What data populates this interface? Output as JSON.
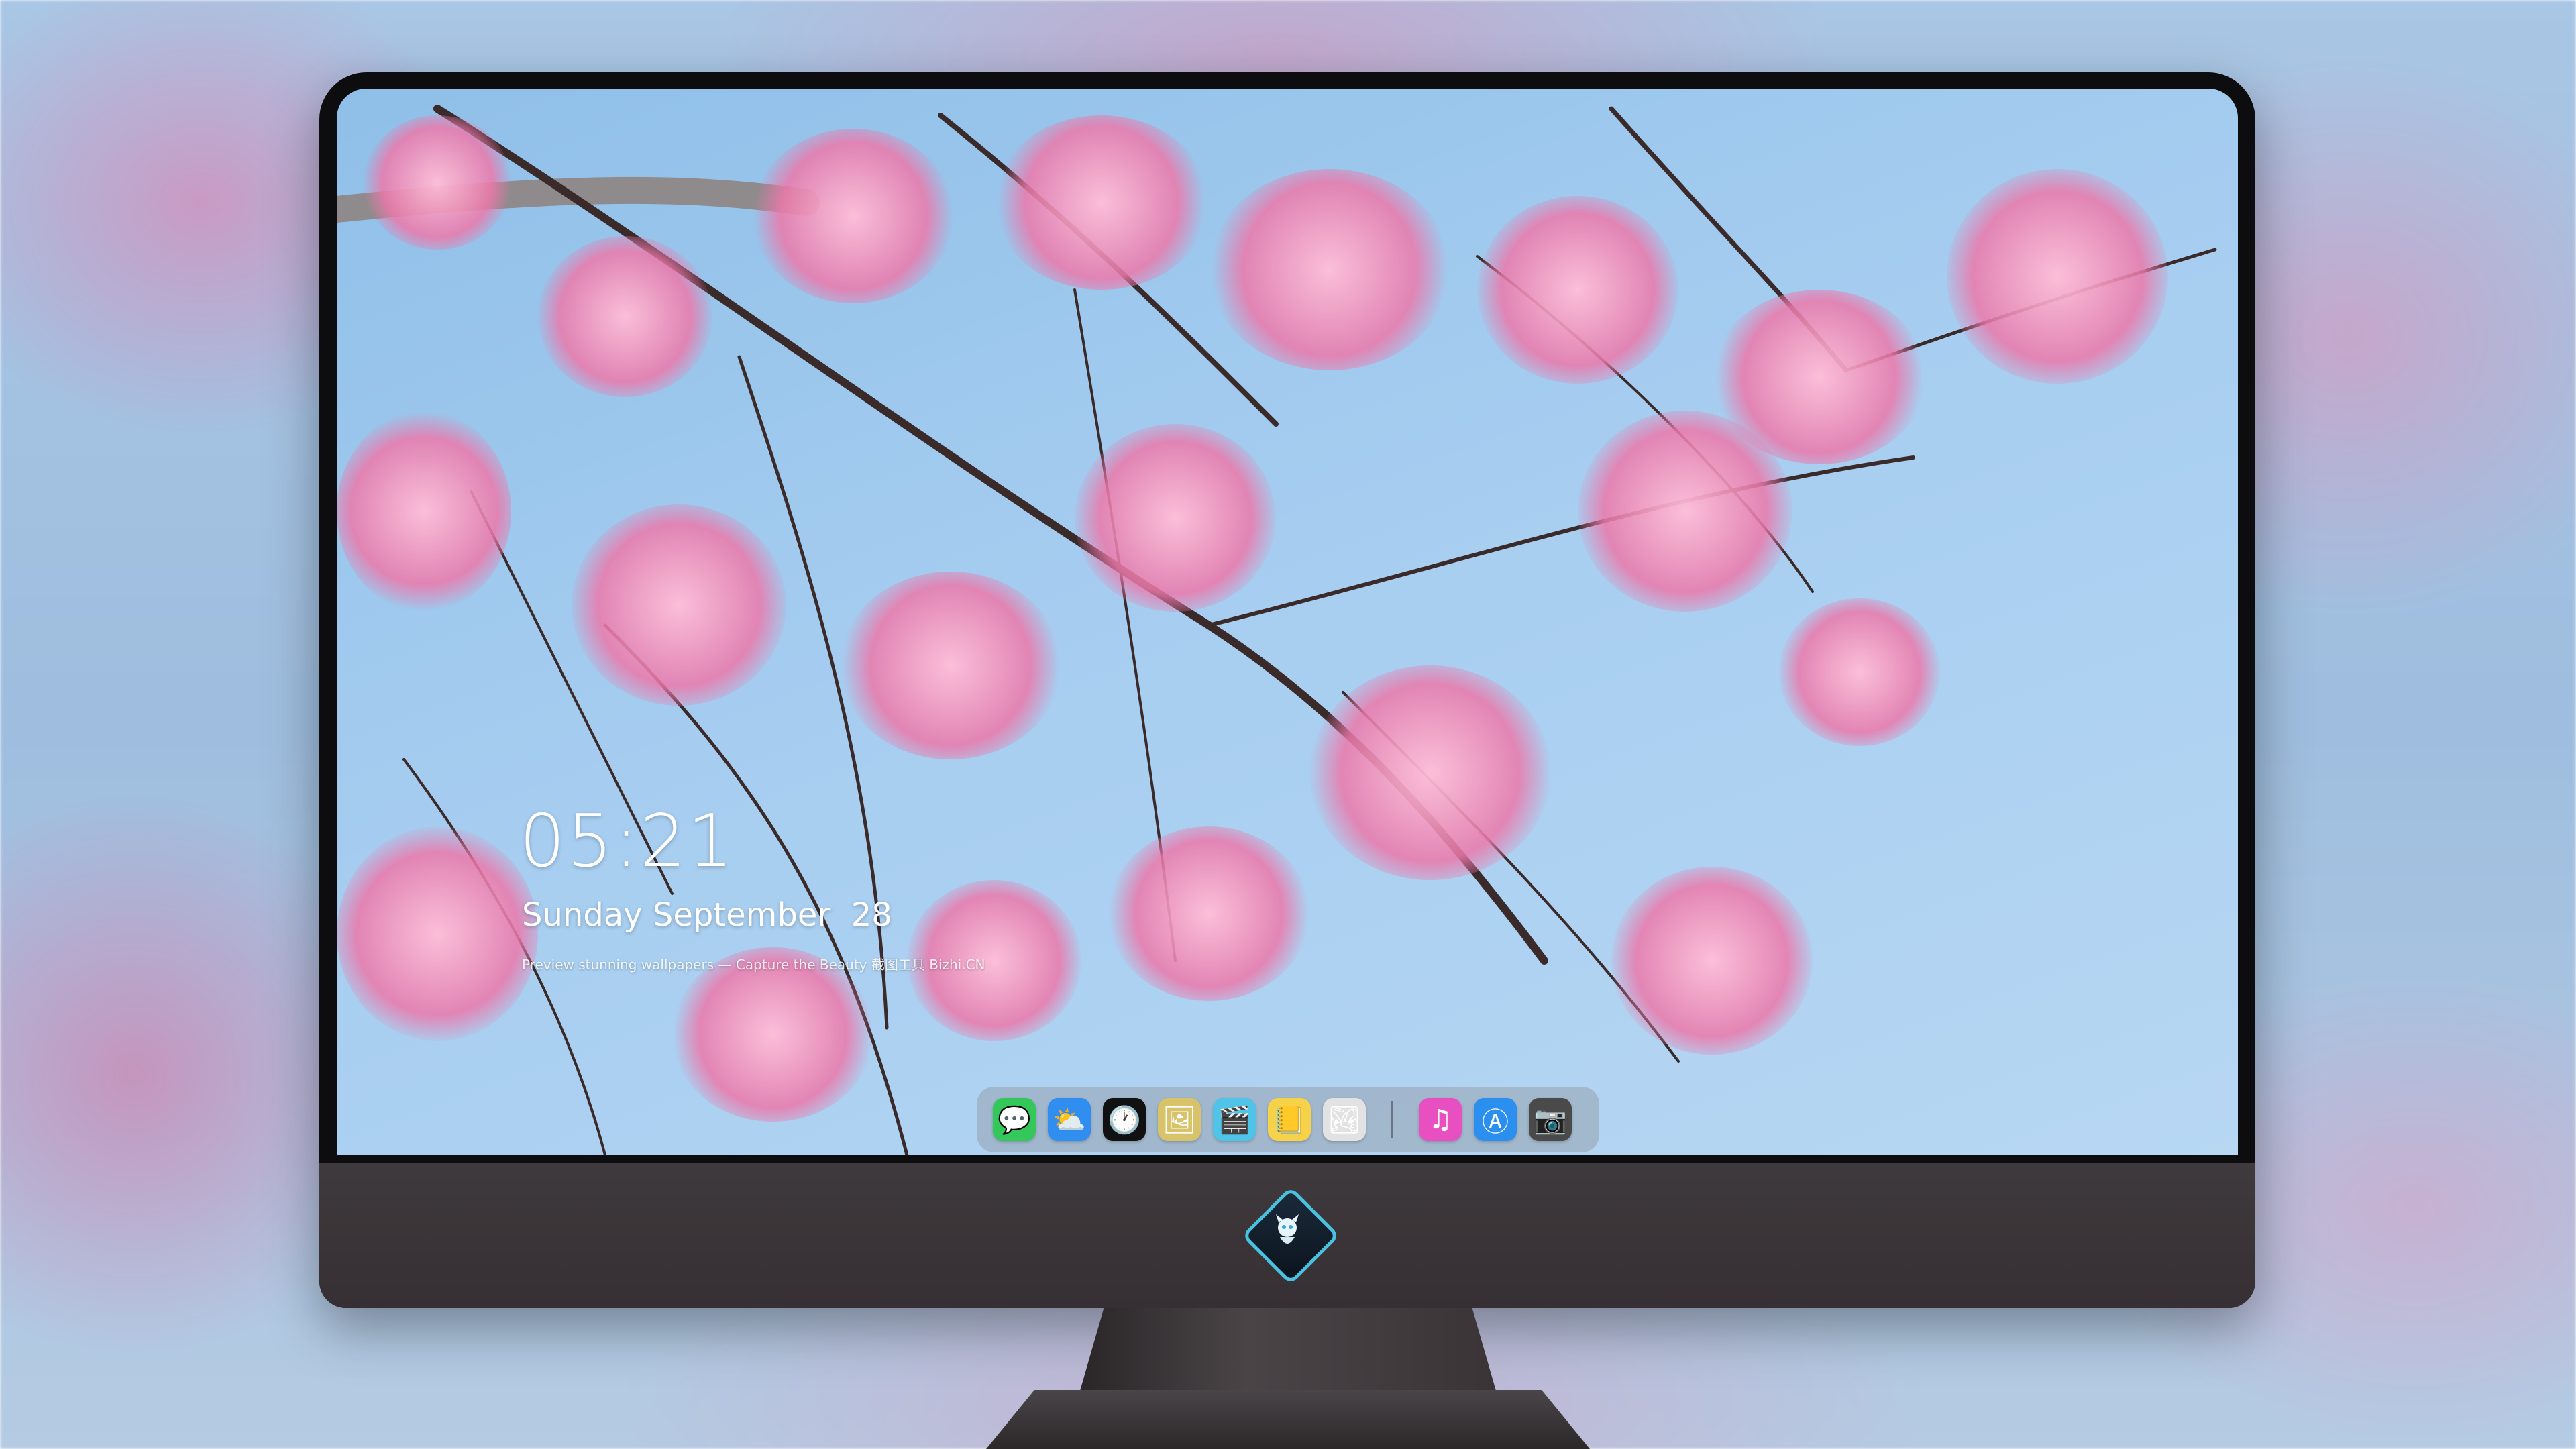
{
  "lockscreen": {
    "time": "05:21",
    "date": "Sunday September  28",
    "caption": "Preview stunning wallpapers — Capture the Beauty 截图工具 Bizhi.CN"
  },
  "dock": {
    "items": [
      {
        "name": "messages-icon",
        "glyph": "💬",
        "color": "#34c759"
      },
      {
        "name": "weather-icon",
        "glyph": "⛅",
        "color": "#2f8ef0"
      },
      {
        "name": "clock-icon",
        "glyph": "🕐",
        "color": "#111111"
      },
      {
        "name": "preview-icon",
        "glyph": "🖼",
        "color": "#d8c36a"
      },
      {
        "name": "video-editor-icon",
        "glyph": "🎬",
        "color": "#4fc3e8"
      },
      {
        "name": "notes-icon",
        "glyph": "📒",
        "color": "#f6d24b"
      },
      {
        "name": "photo-booth-icon",
        "glyph": "🏞",
        "color": "#e2e2e2"
      }
    ],
    "recent_items": [
      {
        "name": "music-icon",
        "glyph": "♫",
        "color": "#e84fc0"
      },
      {
        "name": "app-store-icon",
        "glyph": "Ⓐ",
        "color": "#2b8ff0"
      },
      {
        "name": "camera-icon",
        "glyph": "📷",
        "color": "#4a4a4a"
      }
    ]
  }
}
